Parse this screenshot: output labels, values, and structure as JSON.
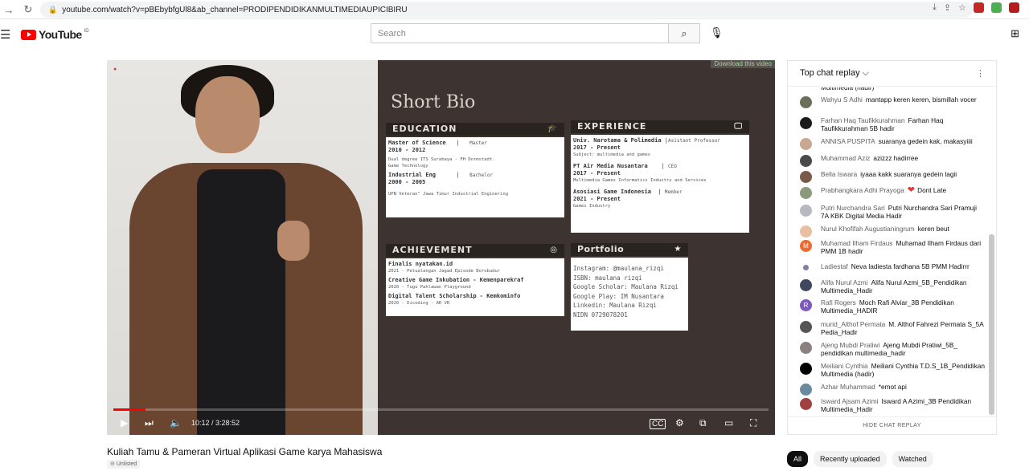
{
  "browser": {
    "url": "youtube.com/watch?v=pBEbybfgUl8&ab_channel=PRODIPENDIDIKANMULTIMEDIAUPICIBIRU"
  },
  "header": {
    "logo_text": "YouTube",
    "country": "ID",
    "search_placeholder": "Search"
  },
  "video": {
    "time": "10:12 / 3:28:52",
    "progress": 0.049,
    "download_label": "Download this video",
    "slide": {
      "title": "Short Bio",
      "education": {
        "heading": "EDUCATION",
        "entries": [
          {
            "line1": "Master of Science",
            "degree": "Master",
            "years": "2010 - 2012",
            "detail": "Dual degree ITS Surabaya - FH Dormstadt.",
            "detail2": "Game Technology"
          },
          {
            "line1": "Industrial Eng",
            "degree": "Bachelor",
            "years": "2000 - 2005",
            "detail": "UPN Veteran\" Jawa Timur Industrial Enginering"
          }
        ]
      },
      "experience": {
        "heading": "EXPERIENCE",
        "entries": [
          {
            "line1": "Univ. Narotama & Polimedia",
            "role": "Asistant Professor",
            "years": "2017 - Present",
            "detail": "Subject: multimedia and games"
          },
          {
            "line1": "PT Air Media Nusantara",
            "role": "CEO",
            "years": "2017 - Present",
            "detail": "Multimedia Games Informatics Industry and Services"
          },
          {
            "line1": "Asosiasi Game Indonesia",
            "role": "Member",
            "years": "2021 - Present",
            "detail": "Games Industry"
          }
        ]
      },
      "achievement": {
        "heading": "ACHIEVEMENT",
        "entries": [
          {
            "title": "Finalis nyatakan.id",
            "detail": "2021 - Petualangan Jagad Episode Borobudur"
          },
          {
            "title": "Creative Game Inkubation - Kemenparekraf",
            "detail": "2020 - Tugu Pahlawan Playground"
          },
          {
            "title": "Digital Talent Scholarship - Kemkominfo",
            "detail": "2020 - Dicoding - AR VR"
          }
        ]
      },
      "portfolio": {
        "heading": "Portfolio",
        "lines": [
          "Instagram: @maulana_rizqi",
          "ISBN: maulana rizqi",
          "Google Scholar: Maulana Rizqi",
          "Google Play: IM Nusantara",
          "Linkedin: Maulana Rizqi",
          "NIDN 0729078201"
        ]
      }
    }
  },
  "chat": {
    "title": "Top chat replay",
    "footer": "HIDE CHAT REPLAY",
    "messages": [
      {
        "author": "",
        "text": "Multimedia (hadir)",
        "color": "#ffffff"
      },
      {
        "author": "Wahyu S Adhi",
        "text": "mantapp keren keren, bismillah vocer",
        "color": "#6b6f5a"
      },
      {
        "author": "Farhan Haq Taufikkurahman",
        "text": "Farhan Haq Taufikkurahman 5B hadir",
        "color": "#1b1b1b"
      },
      {
        "author": "ANNISA PUSPITA",
        "text": "suaranya gedein kak, makasyiiii",
        "color": "#c8a890"
      },
      {
        "author": "Muhammad Aziz",
        "text": "azizzz hadirree",
        "color": "#4a4a4a"
      },
      {
        "author": "Bella Iswara",
        "text": "iyaaa kakk suaranya gedein lagii",
        "color": "#7a5a4a"
      },
      {
        "author": "Prabhangkara Adhi Prayoga",
        "text": "Dont Late",
        "color": "#8a9a7a"
      },
      {
        "author": "Putri Nurchandra Sari",
        "text": "Putri Nurchandra Sari Pramuji 7A KBK Digital Media Hadir",
        "color": "#b8b8c0"
      },
      {
        "author": "Nurul Khofifah Augustianingrum",
        "text": "keren beut",
        "color": "#e8c0a0"
      },
      {
        "author": "Muhamad Ilham Firdaus",
        "text": "Muhamad Ilham Firdaus dari PMM 1B hadir",
        "color": "#f06a2e"
      },
      {
        "author": "Ladiestaf",
        "text": "Neva ladiesta fardhana 5B PMM Hadirrr",
        "color": "#8080a0"
      },
      {
        "author": "Alifa Nurul Azmi",
        "text": "Alifa Nurul Azmi_5B_Pendidikan Multimedia_Hadir",
        "color": "#404860"
      },
      {
        "author": "Rafi Rogers",
        "text": "Moch Rafi Alviar_3B Pendidikan Multimedia_HADIR",
        "color": "#7e57c2"
      },
      {
        "author": "murid_Althof Permata",
        "text": "M. Althof Fahrezi Permata S_5A Pedia_Hadir",
        "color": "#555555"
      },
      {
        "author": "Ajeng Mubdi Pratiwi",
        "text": "Ajeng Mubdi Pratiwi_5B_ pendidikan multimedia_hadir",
        "color": "#8a8080"
      },
      {
        "author": "Meiliani Cynthia",
        "text": "Meiliani Cynthia T.D.S_1B_Pendidikan Multimedia (hadir)",
        "color": "#000000"
      },
      {
        "author": "Azhar Muhammad",
        "text": "*emot api",
        "color": "#6a8aa0"
      },
      {
        "author": "Isward Ajsam Azimi",
        "text": "Isward A Azimi_3B Pendidikan Multimedia_Hadir",
        "color": "#a04040"
      }
    ]
  },
  "below": {
    "title": "Kuliah Tamu & Pameran Virtual Aplikasi Game karya Mahasiswa",
    "badge": "Unlisted",
    "chips": [
      "All",
      "Recently uploaded",
      "Watched"
    ]
  }
}
